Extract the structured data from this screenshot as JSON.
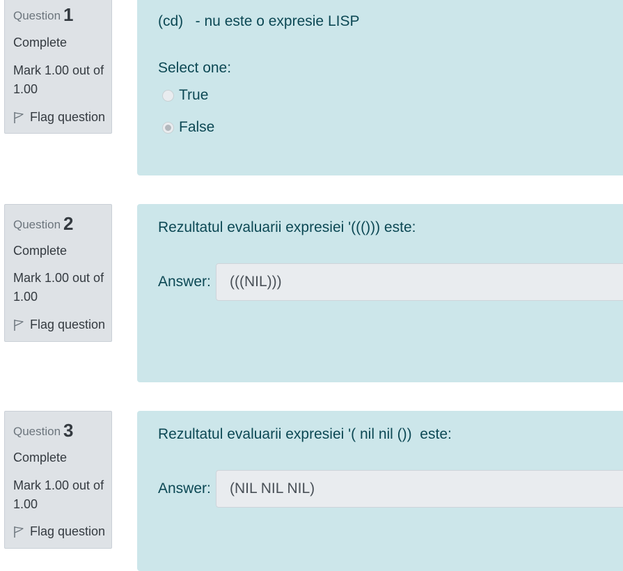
{
  "questions": [
    {
      "label": "Question",
      "number": "1",
      "state": "Complete",
      "grade": "Mark 1.00 out of 1.00",
      "flag_label": "Flag question",
      "text": "(cd)   - nu este o expresie LISP",
      "prompt": "Select one:",
      "options": [
        {
          "label": "True",
          "checked": false
        },
        {
          "label": "False",
          "checked": true
        }
      ]
    },
    {
      "label": "Question",
      "number": "2",
      "state": "Complete",
      "grade": "Mark 1.00 out of 1.00",
      "flag_label": "Flag question",
      "text": "Rezultatul evaluarii expresiei '((())) este:",
      "answer_label": "Answer:",
      "answer_value": "(((NIL)))"
    },
    {
      "label": "Question",
      "number": "3",
      "state": "Complete",
      "grade": "Mark 1.00 out of 1.00",
      "flag_label": "Flag question",
      "text": "Rezultatul evaluarii expresiei '( nil nil ())  este:",
      "answer_label": "Answer:",
      "answer_value": "(NIL NIL NIL)"
    }
  ]
}
